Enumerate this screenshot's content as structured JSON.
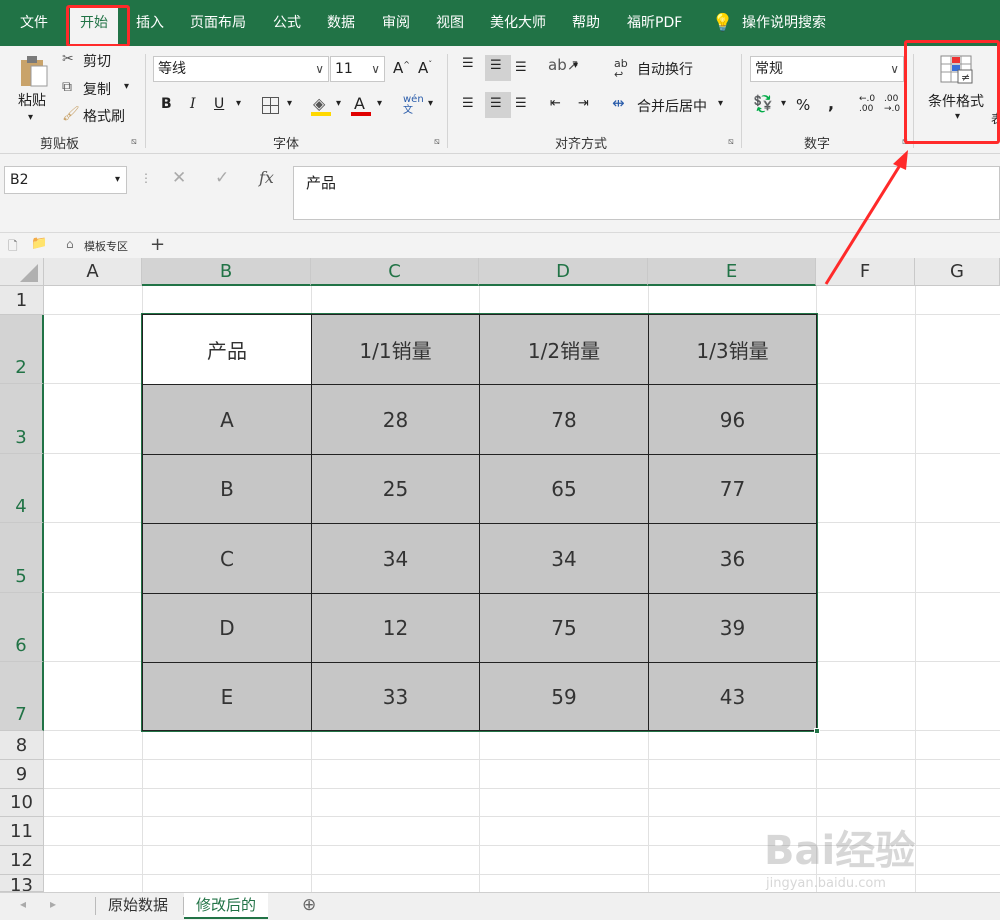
{
  "menu": {
    "tabs": [
      "文件",
      "开始",
      "插入",
      "页面布局",
      "公式",
      "数据",
      "审阅",
      "视图",
      "美化大师",
      "帮助",
      "福昕PDF"
    ],
    "active_tab": "开始",
    "search_label": "操作说明搜索"
  },
  "ribbon": {
    "clipboard": {
      "paste": "粘贴",
      "cut": "剪切",
      "copy": "复制",
      "format_painter": "格式刷",
      "group": "剪贴板"
    },
    "font": {
      "name": "等线",
      "size": "11",
      "bold": "B",
      "italic": "I",
      "underline": "U",
      "group": "字体"
    },
    "align": {
      "wrap": "自动换行",
      "merge": "合并后居中",
      "group": "对齐方式"
    },
    "number": {
      "format": "常规",
      "percent": "%",
      "comma": ",",
      "group": "数字"
    },
    "styles": {
      "conditional": "条件格式",
      "next": "表"
    }
  },
  "formula_bar": {
    "name_box": "B2",
    "content": "产品",
    "fx": "fx"
  },
  "file_tabs": {
    "template": "模板专区"
  },
  "columns": [
    "A",
    "B",
    "C",
    "D",
    "E",
    "F",
    "G"
  ],
  "rows": [
    "1",
    "2",
    "3",
    "4",
    "5",
    "6",
    "7",
    "8",
    "9",
    "10",
    "11",
    "12",
    "13"
  ],
  "table": {
    "headers": [
      "产品",
      "1/1销量",
      "1/2销量",
      "1/3销量"
    ],
    "rows": [
      [
        "A",
        "28",
        "78",
        "96"
      ],
      [
        "B",
        "25",
        "65",
        "77"
      ],
      [
        "C",
        "34",
        "34",
        "36"
      ],
      [
        "D",
        "12",
        "75",
        "39"
      ],
      [
        "E",
        "33",
        "59",
        "43"
      ]
    ]
  },
  "sheet_tabs": [
    "原始数据",
    "修改后的"
  ],
  "active_sheet": "修改后的",
  "watermark": {
    "brand": "Bai经验",
    "url": "jingyan.baidu.com"
  },
  "colors": {
    "excel_green": "#217346",
    "highlight_red": "#ff2a2a",
    "table_fill": "#c6c6c6"
  }
}
